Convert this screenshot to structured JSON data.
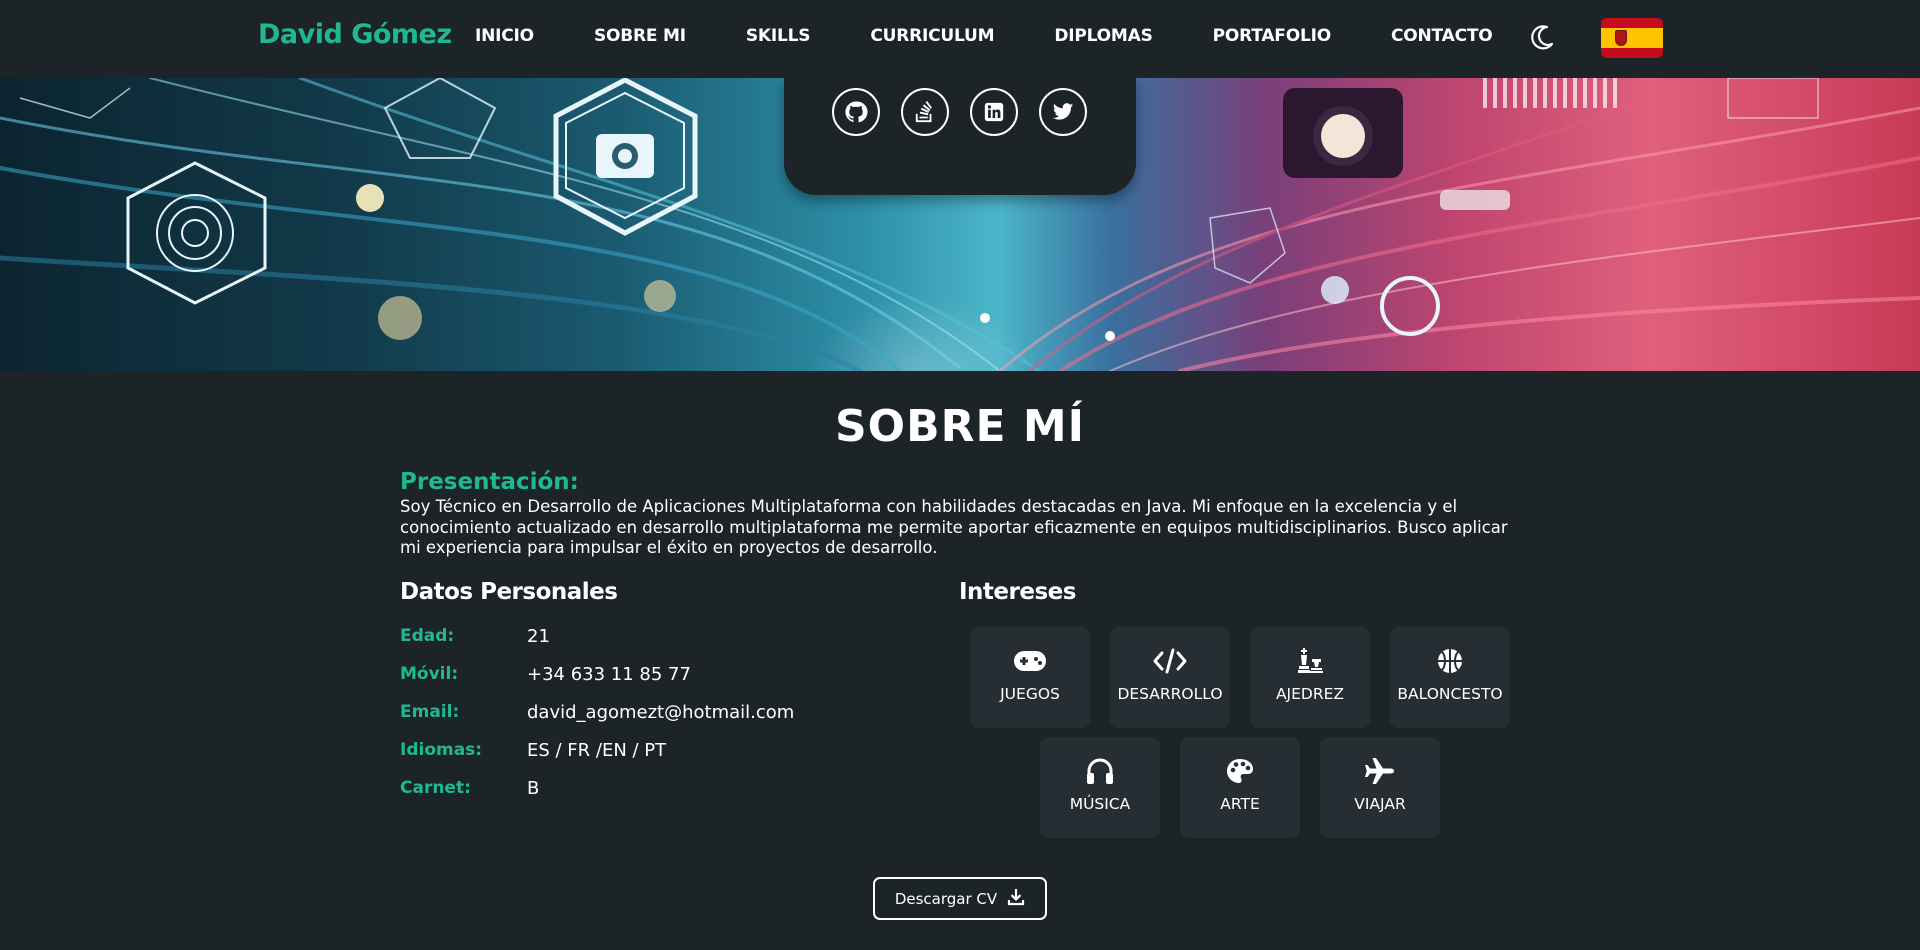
{
  "navbar": {
    "brand": "David Gómez",
    "items": [
      "INICIO",
      "SOBRE MI",
      "SKILLS",
      "CURRICULUM",
      "DIPLOMAS",
      "PORTAFOLIO",
      "CONTACTO"
    ],
    "theme_icon": "moon-icon",
    "language_icon": "spain-flag-icon"
  },
  "social": {
    "icons": [
      "github-icon",
      "stackoverflow-icon",
      "linkedin-icon",
      "twitter-icon"
    ]
  },
  "about": {
    "title": "SOBRE MÍ",
    "presentation_title": "Presentación:",
    "presentation_text": "Soy Técnico en Desarrollo de Aplicaciones Multiplataforma con habilidades destacadas en Java. Mi enfoque en la excelencia y el conocimiento actualizado en desarrollo multiplataforma me permite aportar eficazmente en equipos multidisciplinarios. Busco aplicar mi experiencia para impulsar el éxito en proyectos de desarrollo.",
    "personal_title": "Datos Personales",
    "personal": [
      {
        "label": "Edad:",
        "value": "21"
      },
      {
        "label": "Móvil:",
        "value": "+34 633 11 85 77"
      },
      {
        "label": "Email:",
        "value": "david_agomezt@hotmail.com"
      },
      {
        "label": "Idiomas:",
        "value": "ES / FR /EN / PT"
      },
      {
        "label": "Carnet:",
        "value": "B"
      }
    ],
    "interests_title": "Intereses",
    "interests": [
      {
        "label": "JUEGOS",
        "icon": "gamepad-icon"
      },
      {
        "label": "DESARROLLO",
        "icon": "code-icon"
      },
      {
        "label": "AJEDREZ",
        "icon": "chess-icon"
      },
      {
        "label": "BALONCESTO",
        "icon": "basketball-icon"
      },
      {
        "label": "MÚSICA",
        "icon": "headphones-icon"
      },
      {
        "label": "ARTE",
        "icon": "palette-icon"
      },
      {
        "label": "VIAJAR",
        "icon": "plane-icon"
      }
    ],
    "download_label": "Descargar CV",
    "download_icon": "download-icon"
  },
  "colors": {
    "accent": "#1fb891",
    "background": "#1d2428",
    "card": "#262e33"
  }
}
